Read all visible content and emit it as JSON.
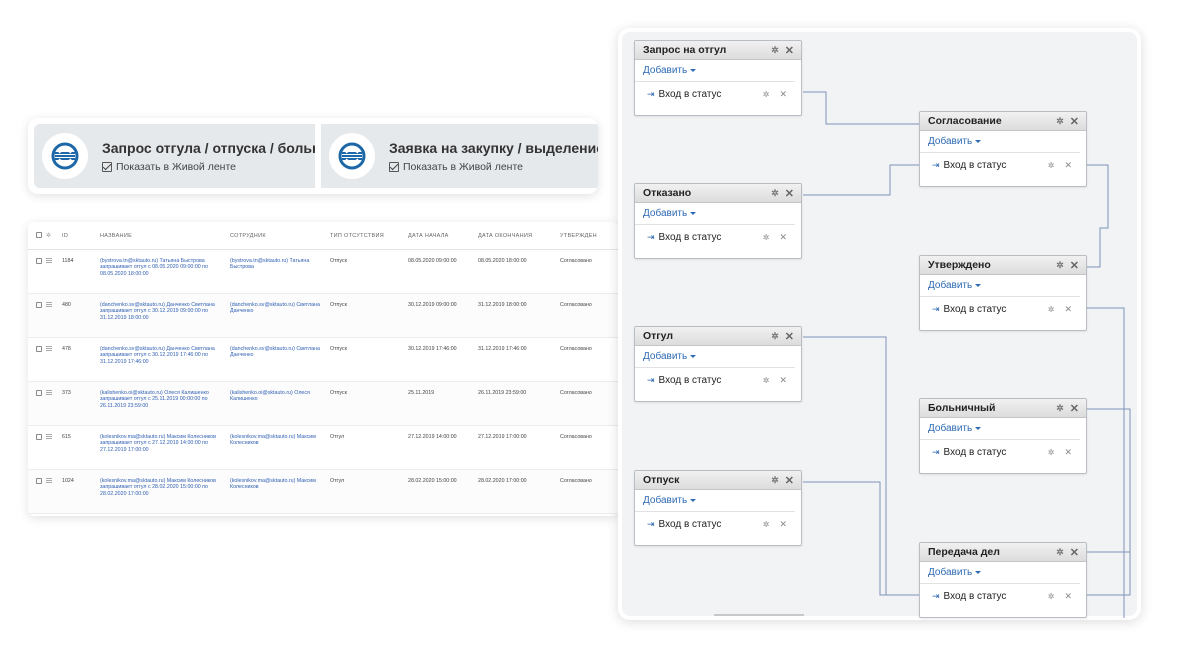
{
  "process_cards": [
    {
      "title": "Запрос отгула / отпуска / больни...",
      "checkbox_label": "Показать в Живой ленте",
      "checked": true
    },
    {
      "title": "Заявка на закупку / выделение с...",
      "checkbox_label": "Показать в Живой ленте",
      "checked": true
    }
  ],
  "table": {
    "headers": [
      "ID",
      "НАЗВАНИЕ",
      "СОТРУДНИК",
      "ТИП ОТСУТСТВИЯ",
      "ДАТА НАЧАЛА",
      "ДАТА ОКОНЧАНИЯ",
      "УТВЕРЖДЕН"
    ],
    "rows": [
      {
        "id": "1184",
        "name": "(bystrova.tn@sktauto.ru) Татьяна Быстрова запрашивает отгул с 08.05.2020 09:00:00 по 08.05.2020 18:00:00",
        "employee": "(bystrova.tn@sktauto.ru) Татьяна Быстрова",
        "type": "Отпуск",
        "start": "08.05.2020 09:00:00",
        "end": "08.05.2020 18:00:00",
        "approved": "Согласовано"
      },
      {
        "id": "480",
        "name": "(danchenko.sv@sktauto.ru) Данченко Светлана запрашивает отгул с 30.12.2019 09:00:00 по 31.12.2019 18:00:00",
        "employee": "(danchenko.sv@sktauto.ru) Светлана Данченко",
        "type": "Отпуск",
        "start": "30.12.2019 09:00:00",
        "end": "31.12.2019 18:00:00",
        "approved": "Согласовано"
      },
      {
        "id": "478",
        "name": "(danchenko.sv@sktauto.ru) Данченко Светлана запрашивает отгул с 30.12.2019 17:46:00 по 31.12.2019 17:46:00",
        "employee": "(danchenko.sv@sktauto.ru) Светлана Данченко",
        "type": "Отпуск",
        "start": "30.12.2019 17:46:00",
        "end": "31.12.2019 17:46:00",
        "approved": "Согласовано"
      },
      {
        "id": "373",
        "name": "(kalishenko.oi@sktauto.ru) Олеся Калишенко запрашивает отгул с 25.11.2019 00:00:00 по 26.11.2019 23:59:00",
        "employee": "(kalishenko.oi@sktauto.ru) Олеся Калишенко",
        "type": "Отпуск",
        "start": "25.11.2019",
        "end": "26.11.2019 23:59:00",
        "approved": "Согласовано"
      },
      {
        "id": "615",
        "name": "(kolesnikov.ma@sktauto.ru) Максим Колесников запрашивает отгул с 27.12.2019 14:00:00 по 27.12.2019 17:00:00",
        "employee": "(kolesnikov.ma@sktauto.ru) Максим Колесников",
        "type": "Отгул",
        "start": "27.12.2019 14:00:00",
        "end": "27.12.2019 17:00:00",
        "approved": "Согласовано"
      },
      {
        "id": "1024",
        "name": "(kolesnikov.ma@sktauto.ru) Максим Колесников запрашивает отгул с 28.02.2020 15:00:00 по 28.02.2020 17:00:00",
        "employee": "(kolesnikov.ma@sktauto.ru) Максим Колесников",
        "type": "Отгул",
        "start": "28.02.2020 15:00:00",
        "end": "28.02.2020 17:00:00",
        "approved": "Согласовано"
      }
    ]
  },
  "workflow": {
    "nodes": [
      {
        "title": "Запрос на отгул",
        "add_label": "Добавить",
        "entry_label": "Вход в статус"
      },
      {
        "title": "Согласование",
        "add_label": "Добавить",
        "entry_label": "Вход в статус"
      },
      {
        "title": "Отказано",
        "add_label": "Добавить",
        "entry_label": "Вход в статус"
      },
      {
        "title": "Утверждено",
        "add_label": "Добавить",
        "entry_label": "Вход в статус"
      },
      {
        "title": "Отгул",
        "add_label": "Добавить",
        "entry_label": "Вход в статус"
      },
      {
        "title": "Больничный",
        "add_label": "Добавить",
        "entry_label": "Вход в статус"
      },
      {
        "title": "Отпуск",
        "add_label": "Добавить",
        "entry_label": "Вход в статус"
      },
      {
        "title": "Передача дел",
        "add_label": "Добавить",
        "entry_label": "Вход в статус"
      }
    ],
    "wire_color": "#7f93bd"
  },
  "colors": {
    "link": "#2d69b4",
    "card_bg": "#e6e9ec",
    "logo_brand": "#1c67a8"
  }
}
